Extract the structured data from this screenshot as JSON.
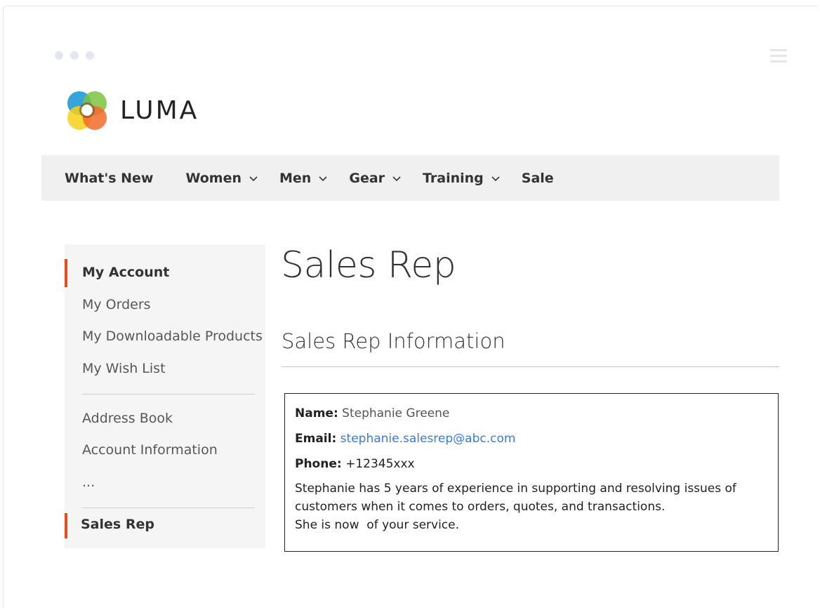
{
  "logo": {
    "text": "LUMA"
  },
  "nav": {
    "items": [
      {
        "label": "What's New",
        "has_dropdown": false
      },
      {
        "label": "Women",
        "has_dropdown": true
      },
      {
        "label": "Men",
        "has_dropdown": true
      },
      {
        "label": "Gear",
        "has_dropdown": true
      },
      {
        "label": "Training",
        "has_dropdown": true
      },
      {
        "label": "Sale",
        "has_dropdown": false
      }
    ]
  },
  "sidebar": {
    "items": [
      {
        "label": "My Account",
        "active": true
      },
      {
        "label": "My Orders"
      },
      {
        "label": "My Downloadable Products"
      },
      {
        "label": "My Wish List"
      },
      {
        "label": "Address Book"
      },
      {
        "label": "Account Information"
      },
      {
        "label": "..."
      },
      {
        "label": "Sales Rep",
        "active": true
      }
    ],
    "accent_color": "#e8491d"
  },
  "page": {
    "title": "Sales Rep",
    "section_title": "Sales Rep Information"
  },
  "rep": {
    "name_label": "Name:",
    "name": "Stephanie Greene",
    "email_label": "Email:",
    "email": "stephanie.salesrep@abc.com",
    "phone_label": "Phone:",
    "phone": "+12345xxx",
    "bio_line1": "Stephanie has 5 years of experience in supporting and resolving issues of",
    "bio_line2": "customers when it comes to orders, quotes, and transactions.",
    "bio_line3": "She is now  of your service."
  },
  "colors": {
    "link": "#3e7ad0",
    "nav_bg": "#f0f0f0",
    "sidebar_bg": "#f5f5f5"
  }
}
